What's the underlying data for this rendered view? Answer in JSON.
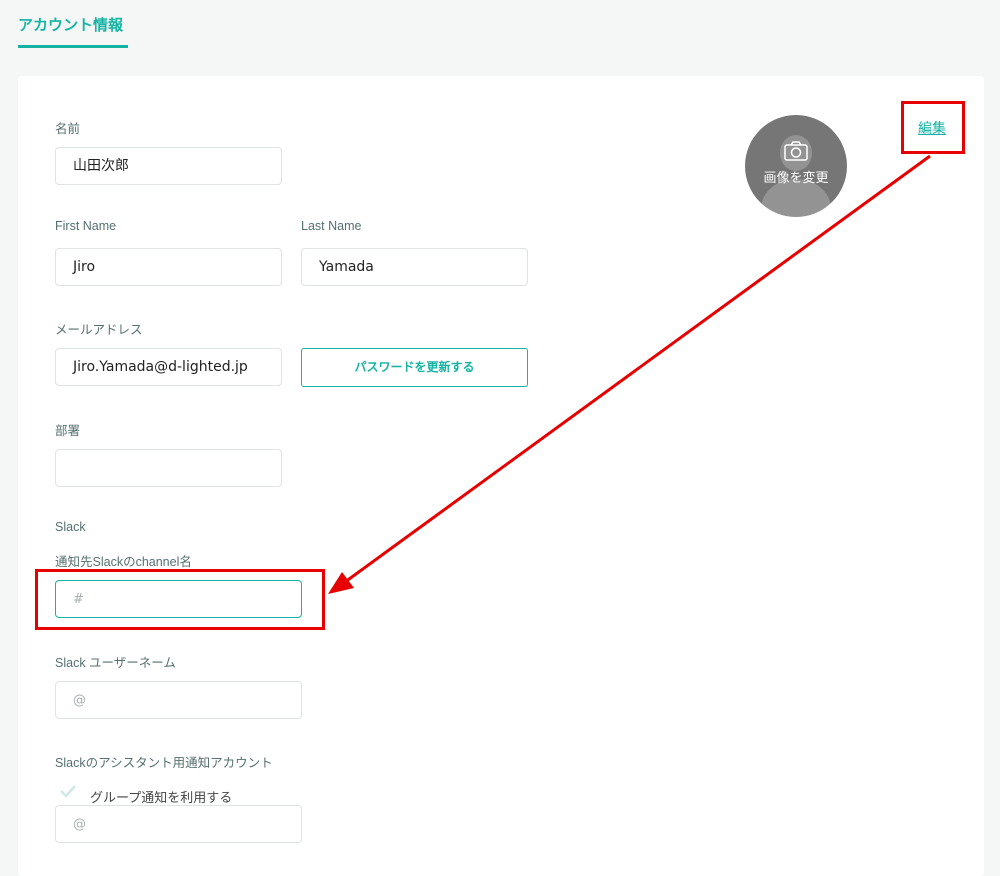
{
  "tab": {
    "label": "アカウント情報"
  },
  "fields": {
    "name": {
      "label": "名前",
      "value": "山田次郎"
    },
    "first_name": {
      "label": "First Name",
      "value": "Jiro"
    },
    "last_name": {
      "label": "Last Name",
      "value": "Yamada"
    },
    "email": {
      "label": "メールアドレス",
      "value": "Jiro.Yamada@d-lighted.jp"
    },
    "department": {
      "label": "部署",
      "value": ""
    },
    "slack_section": {
      "label": "Slack"
    },
    "slack_channel": {
      "label": "通知先Slackのchannel名",
      "placeholder": "#"
    },
    "slack_username": {
      "label": "Slack ユーザーネーム",
      "placeholder": "@"
    },
    "slack_assistant": {
      "label": "Slackのアシスタント用通知アカウント",
      "checkbox_label": "グループ通知を利用する",
      "checked": true,
      "placeholder": "@"
    }
  },
  "buttons": {
    "update_password": "パスワードを更新する"
  },
  "avatar": {
    "change_image_label": "画像を変更"
  },
  "edit_link": "編集",
  "colors": {
    "accent": "#14b3a4",
    "annotation": "#e60000",
    "background": "#f5f7f7"
  },
  "icons": {
    "camera": "camera-icon",
    "check": "check-icon"
  }
}
